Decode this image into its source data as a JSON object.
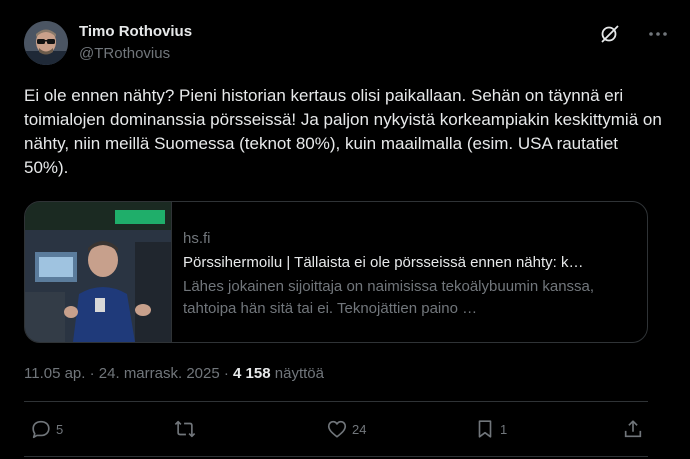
{
  "author": {
    "name": "Timo Rothovius",
    "handle": "@TRothovius"
  },
  "tweet": {
    "text": "Ei ole ennen nähty? Pieni historian kertaus olisi paikallaan. Sehän on täynnä eri toimialojen dominanssia pörsseissä! Ja paljon nykyistä korkeampiakin keskittymiä on nähty, niin meillä Suomessa (teknot 80%), kuin maailmalla (esim. USA rautatiet 50%)."
  },
  "link_card": {
    "domain": "hs.fi",
    "title": "Pörssihermoilu | Tällaista ei ole pörsseissä ennen nähty: k…",
    "description": "Lähes jokainen sijoittaja on naimisissa tekoälybuumin kanssa, tahtoipa hän sitä tai ei. Teknojättien paino …"
  },
  "meta": {
    "time": "11.05 ap.",
    "separator": " · ",
    "date": "24. marrask. 2025",
    "views_count": "4 158",
    "views_label": " näyttöä"
  },
  "actions": {
    "replies": "5",
    "reposts": "",
    "likes": "24",
    "bookmarks": "1"
  },
  "icons": [
    "grok-icon",
    "more-icon",
    "reply-icon",
    "repost-icon",
    "like-icon",
    "bookmark-icon",
    "share-icon"
  ],
  "colors": {
    "background": "#000000",
    "text": "#e7e9ea",
    "secondary": "#71767b",
    "border": "#2f3336"
  }
}
